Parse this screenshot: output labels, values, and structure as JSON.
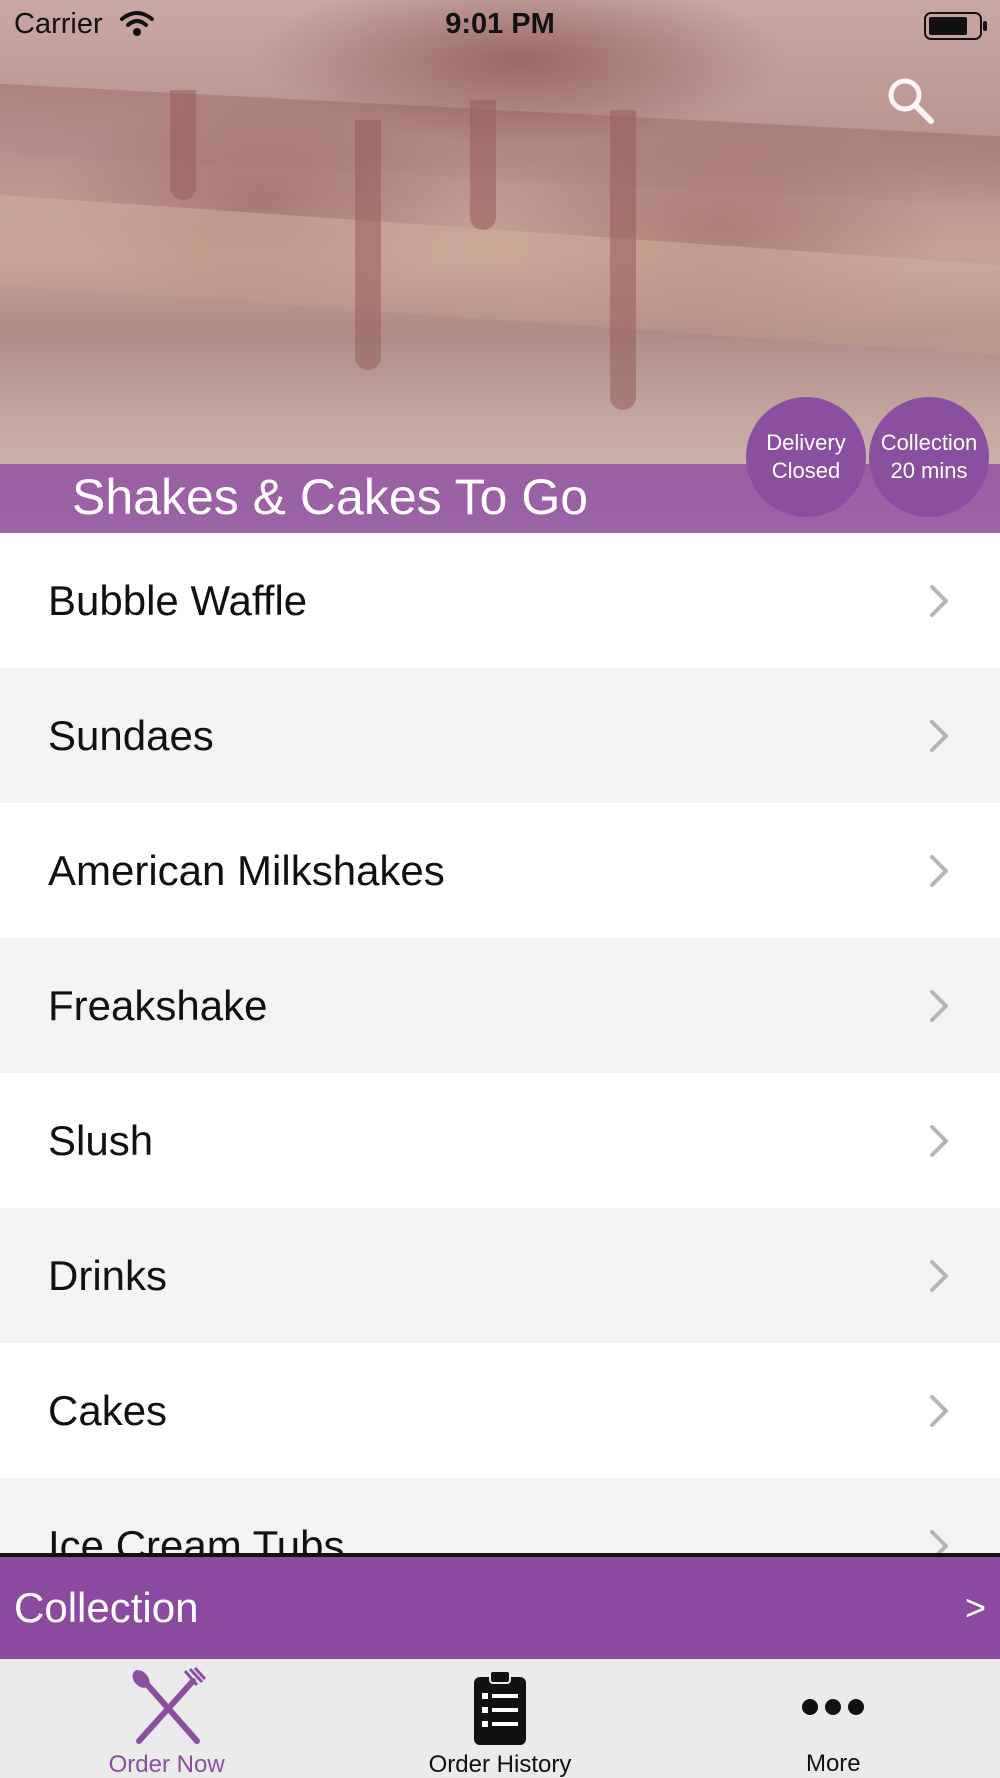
{
  "status_bar": {
    "carrier": "Carrier",
    "time": "9:01 PM"
  },
  "hero": {
    "title": "Shakes & Cakes To Go"
  },
  "badges": {
    "delivery": {
      "line1": "Delivery",
      "line2": "Closed"
    },
    "collection": {
      "line1": "Collection",
      "line2": "20 mins"
    }
  },
  "menu": {
    "items": [
      {
        "label": "Bubble Waffle"
      },
      {
        "label": "Sundaes"
      },
      {
        "label": "American Milkshakes"
      },
      {
        "label": "Freakshake"
      },
      {
        "label": "Slush"
      },
      {
        "label": "Drinks"
      },
      {
        "label": "Cakes"
      },
      {
        "label": "Ice Cream Tubs"
      }
    ]
  },
  "collection_bar": {
    "label": "Collection",
    "arrow": ">"
  },
  "tabs": [
    {
      "label": "Order Now",
      "icon": "fork-knife-icon",
      "active": true
    },
    {
      "label": "Order History",
      "icon": "clipboard-icon",
      "active": false
    },
    {
      "label": "More",
      "icon": "more-dots-icon",
      "active": false
    }
  ],
  "colors": {
    "accent": "#8b4a9f",
    "active_tab": "#8b4fa0",
    "tab_bar": "#ebebeb",
    "row_alt": "#f3f4f6"
  }
}
